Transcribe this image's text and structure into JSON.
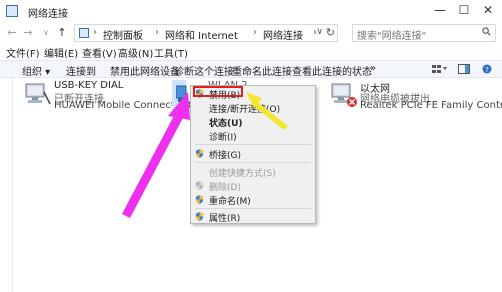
{
  "window": {
    "title": "网络连接",
    "minimize": "—",
    "maximize": "☐",
    "close": "✕"
  },
  "nav": {
    "back": "←",
    "forward": "→",
    "dropdown": "∨",
    "up": "↑"
  },
  "address": {
    "crumbs": [
      "控制面板",
      "网络和 Internet",
      "网络连接"
    ],
    "separator": "›",
    "dropdown": "∨",
    "refresh": "↻"
  },
  "search": {
    "placeholder": "搜索\"网络连接\""
  },
  "menubar": [
    "文件(F)",
    "编辑(E)",
    "查看(V)",
    "高级(N)",
    "工具(T)"
  ],
  "toolbar": {
    "items": [
      "组织 ▾",
      "连接到",
      "禁用此网络设备",
      "诊断这个连接",
      "重命名此连接",
      "查看此连接的状态",
      "»"
    ]
  },
  "adapters": [
    {
      "name": "USB-KEY DIAL",
      "status": "已断开连接",
      "device": "HUAWEI Mobile Connect - 3G ..."
    },
    {
      "name": "WLAN 2",
      "status": "",
      "device": ""
    },
    {
      "name": "以太网",
      "status": "网络电缆被拔出",
      "device": "Realtek PCIe FE Family Control..."
    }
  ],
  "context_menu": {
    "items": [
      {
        "label": "禁用(B)",
        "shield": true,
        "bold": false,
        "disabled": false
      },
      {
        "label": "连接/断开连接(O)",
        "shield": false,
        "bold": false,
        "disabled": false
      },
      {
        "label": "状态(U)",
        "shield": false,
        "bold": true,
        "disabled": false
      },
      {
        "label": "诊断(I)",
        "shield": false,
        "bold": false,
        "disabled": false
      },
      {
        "label": "桥接(G)",
        "shield": true,
        "bold": false,
        "disabled": false
      },
      {
        "label": "创建快捷方式(S)",
        "shield": false,
        "bold": false,
        "disabled": true
      },
      {
        "label": "删除(D)",
        "shield": true,
        "bold": false,
        "disabled": true
      },
      {
        "label": "重命名(M)",
        "shield": true,
        "bold": false,
        "disabled": false
      },
      {
        "label": "属性(R)",
        "shield": true,
        "bold": false,
        "disabled": false
      }
    ]
  },
  "colors": {
    "annotation_arrow_magenta": "#ee30ee",
    "annotation_arrow_yellow": "#f5e533",
    "highlight_box": "#e02020"
  }
}
